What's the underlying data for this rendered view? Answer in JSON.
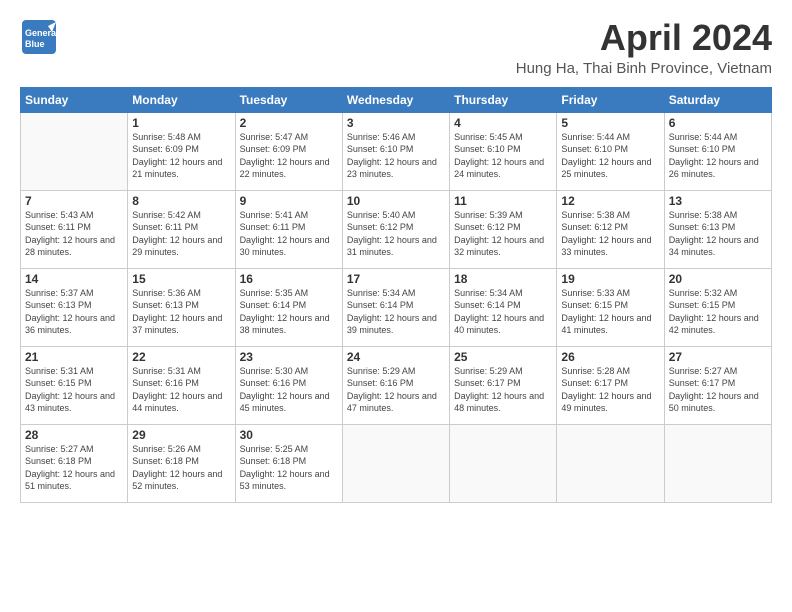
{
  "header": {
    "logo_general": "General",
    "logo_blue": "Blue",
    "month_title": "April 2024",
    "location": "Hung Ha, Thai Binh Province, Vietnam"
  },
  "days_of_week": [
    "Sunday",
    "Monday",
    "Tuesday",
    "Wednesday",
    "Thursday",
    "Friday",
    "Saturday"
  ],
  "weeks": [
    [
      {
        "day": "",
        "sunrise": "",
        "sunset": "",
        "daylight": ""
      },
      {
        "day": "1",
        "sunrise": "Sunrise: 5:48 AM",
        "sunset": "Sunset: 6:09 PM",
        "daylight": "Daylight: 12 hours and 21 minutes."
      },
      {
        "day": "2",
        "sunrise": "Sunrise: 5:47 AM",
        "sunset": "Sunset: 6:09 PM",
        "daylight": "Daylight: 12 hours and 22 minutes."
      },
      {
        "day": "3",
        "sunrise": "Sunrise: 5:46 AM",
        "sunset": "Sunset: 6:10 PM",
        "daylight": "Daylight: 12 hours and 23 minutes."
      },
      {
        "day": "4",
        "sunrise": "Sunrise: 5:45 AM",
        "sunset": "Sunset: 6:10 PM",
        "daylight": "Daylight: 12 hours and 24 minutes."
      },
      {
        "day": "5",
        "sunrise": "Sunrise: 5:44 AM",
        "sunset": "Sunset: 6:10 PM",
        "daylight": "Daylight: 12 hours and 25 minutes."
      },
      {
        "day": "6",
        "sunrise": "Sunrise: 5:44 AM",
        "sunset": "Sunset: 6:10 PM",
        "daylight": "Daylight: 12 hours and 26 minutes."
      }
    ],
    [
      {
        "day": "7",
        "sunrise": "Sunrise: 5:43 AM",
        "sunset": "Sunset: 6:11 PM",
        "daylight": "Daylight: 12 hours and 28 minutes."
      },
      {
        "day": "8",
        "sunrise": "Sunrise: 5:42 AM",
        "sunset": "Sunset: 6:11 PM",
        "daylight": "Daylight: 12 hours and 29 minutes."
      },
      {
        "day": "9",
        "sunrise": "Sunrise: 5:41 AM",
        "sunset": "Sunset: 6:11 PM",
        "daylight": "Daylight: 12 hours and 30 minutes."
      },
      {
        "day": "10",
        "sunrise": "Sunrise: 5:40 AM",
        "sunset": "Sunset: 6:12 PM",
        "daylight": "Daylight: 12 hours and 31 minutes."
      },
      {
        "day": "11",
        "sunrise": "Sunrise: 5:39 AM",
        "sunset": "Sunset: 6:12 PM",
        "daylight": "Daylight: 12 hours and 32 minutes."
      },
      {
        "day": "12",
        "sunrise": "Sunrise: 5:38 AM",
        "sunset": "Sunset: 6:12 PM",
        "daylight": "Daylight: 12 hours and 33 minutes."
      },
      {
        "day": "13",
        "sunrise": "Sunrise: 5:38 AM",
        "sunset": "Sunset: 6:13 PM",
        "daylight": "Daylight: 12 hours and 34 minutes."
      }
    ],
    [
      {
        "day": "14",
        "sunrise": "Sunrise: 5:37 AM",
        "sunset": "Sunset: 6:13 PM",
        "daylight": "Daylight: 12 hours and 36 minutes."
      },
      {
        "day": "15",
        "sunrise": "Sunrise: 5:36 AM",
        "sunset": "Sunset: 6:13 PM",
        "daylight": "Daylight: 12 hours and 37 minutes."
      },
      {
        "day": "16",
        "sunrise": "Sunrise: 5:35 AM",
        "sunset": "Sunset: 6:14 PM",
        "daylight": "Daylight: 12 hours and 38 minutes."
      },
      {
        "day": "17",
        "sunrise": "Sunrise: 5:34 AM",
        "sunset": "Sunset: 6:14 PM",
        "daylight": "Daylight: 12 hours and 39 minutes."
      },
      {
        "day": "18",
        "sunrise": "Sunrise: 5:34 AM",
        "sunset": "Sunset: 6:14 PM",
        "daylight": "Daylight: 12 hours and 40 minutes."
      },
      {
        "day": "19",
        "sunrise": "Sunrise: 5:33 AM",
        "sunset": "Sunset: 6:15 PM",
        "daylight": "Daylight: 12 hours and 41 minutes."
      },
      {
        "day": "20",
        "sunrise": "Sunrise: 5:32 AM",
        "sunset": "Sunset: 6:15 PM",
        "daylight": "Daylight: 12 hours and 42 minutes."
      }
    ],
    [
      {
        "day": "21",
        "sunrise": "Sunrise: 5:31 AM",
        "sunset": "Sunset: 6:15 PM",
        "daylight": "Daylight: 12 hours and 43 minutes."
      },
      {
        "day": "22",
        "sunrise": "Sunrise: 5:31 AM",
        "sunset": "Sunset: 6:16 PM",
        "daylight": "Daylight: 12 hours and 44 minutes."
      },
      {
        "day": "23",
        "sunrise": "Sunrise: 5:30 AM",
        "sunset": "Sunset: 6:16 PM",
        "daylight": "Daylight: 12 hours and 45 minutes."
      },
      {
        "day": "24",
        "sunrise": "Sunrise: 5:29 AM",
        "sunset": "Sunset: 6:16 PM",
        "daylight": "Daylight: 12 hours and 47 minutes."
      },
      {
        "day": "25",
        "sunrise": "Sunrise: 5:29 AM",
        "sunset": "Sunset: 6:17 PM",
        "daylight": "Daylight: 12 hours and 48 minutes."
      },
      {
        "day": "26",
        "sunrise": "Sunrise: 5:28 AM",
        "sunset": "Sunset: 6:17 PM",
        "daylight": "Daylight: 12 hours and 49 minutes."
      },
      {
        "day": "27",
        "sunrise": "Sunrise: 5:27 AM",
        "sunset": "Sunset: 6:17 PM",
        "daylight": "Daylight: 12 hours and 50 minutes."
      }
    ],
    [
      {
        "day": "28",
        "sunrise": "Sunrise: 5:27 AM",
        "sunset": "Sunset: 6:18 PM",
        "daylight": "Daylight: 12 hours and 51 minutes."
      },
      {
        "day": "29",
        "sunrise": "Sunrise: 5:26 AM",
        "sunset": "Sunset: 6:18 PM",
        "daylight": "Daylight: 12 hours and 52 minutes."
      },
      {
        "day": "30",
        "sunrise": "Sunrise: 5:25 AM",
        "sunset": "Sunset: 6:18 PM",
        "daylight": "Daylight: 12 hours and 53 minutes."
      },
      {
        "day": "",
        "sunrise": "",
        "sunset": "",
        "daylight": ""
      },
      {
        "day": "",
        "sunrise": "",
        "sunset": "",
        "daylight": ""
      },
      {
        "day": "",
        "sunrise": "",
        "sunset": "",
        "daylight": ""
      },
      {
        "day": "",
        "sunrise": "",
        "sunset": "",
        "daylight": ""
      }
    ]
  ]
}
